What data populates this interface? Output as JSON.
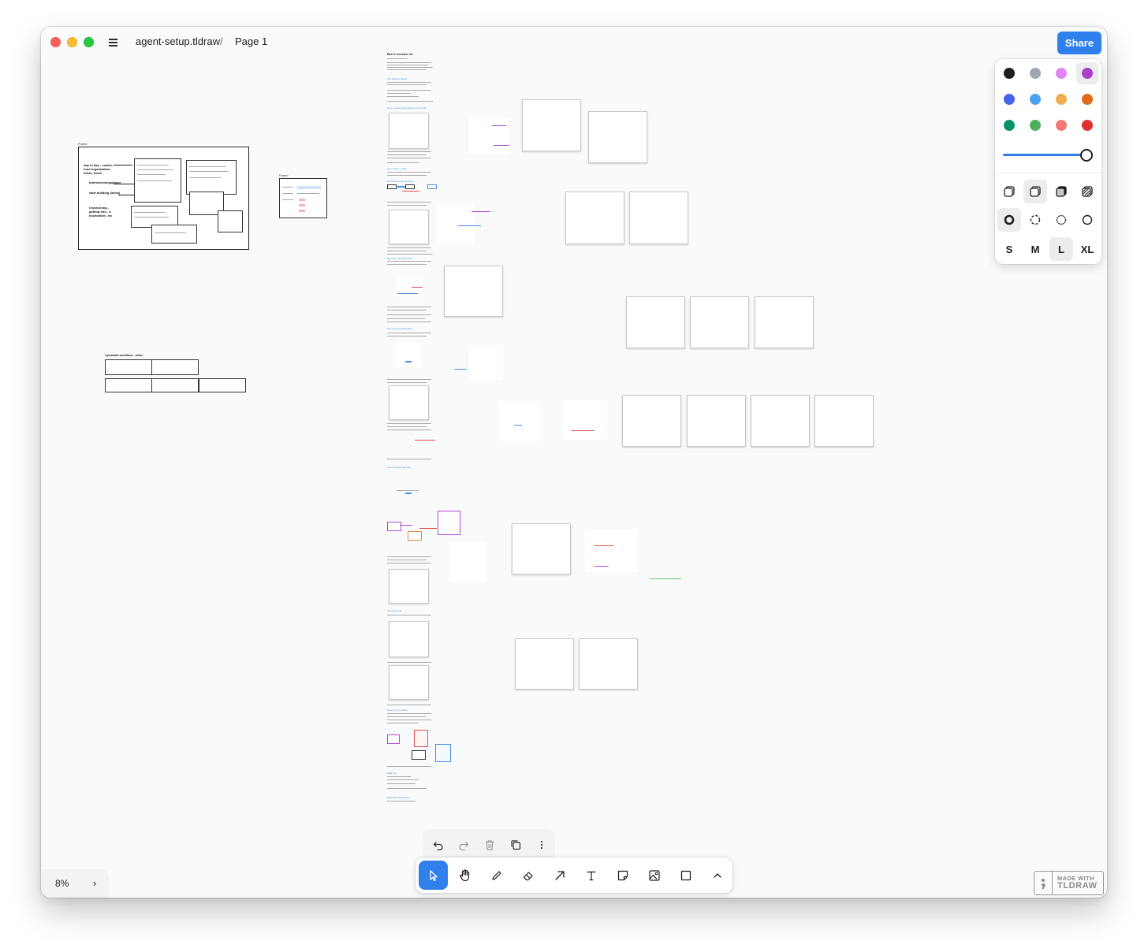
{
  "window": {
    "file_title": "agent-setup.tldraw",
    "separator": "/",
    "page_name": "Page 1",
    "share_label": "Share"
  },
  "canvas": {
    "frame_big_label": "Frame",
    "frame_small_label": "Frame",
    "frame_big_items": [
      "day to day - emails, fund organization, ticket, travel",
      "brainstorming/advice",
      "start building (ideas)",
      "researching - getting info - a bookmarks, etc"
    ],
    "workflow_title": "repeatable workflows - ideas",
    "doc_title": "Ben's session #3",
    "doc_headings": [
      "The starting model",
      "Give it a peek and getting to the code",
      "get context + work",
      "the whole of git (hooking)",
      "Big reset with Postcode",
      "the memory (ideal) kind",
      "Link it product @ code",
      "Using the tool",
      "Here it is on a state",
      "Wrap up",
      "What will the success"
    ]
  },
  "style_panel": {
    "colors": [
      {
        "name": "black",
        "hex": "#1d1d1d"
      },
      {
        "name": "grey",
        "hex": "#9fa8b2"
      },
      {
        "name": "light-violet",
        "hex": "#e085f4"
      },
      {
        "name": "violet",
        "hex": "#ae3ec9"
      },
      {
        "name": "blue",
        "hex": "#4465e9"
      },
      {
        "name": "light-blue",
        "hex": "#4ba1f1"
      },
      {
        "name": "yellow",
        "hex": "#f1ac4b"
      },
      {
        "name": "orange",
        "hex": "#e16919"
      },
      {
        "name": "green",
        "hex": "#099268"
      },
      {
        "name": "light-green",
        "hex": "#4cb05e"
      },
      {
        "name": "light-red",
        "hex": "#f87777"
      },
      {
        "name": "red",
        "hex": "#e03131"
      }
    ],
    "selected_color": "violet",
    "opacity": 1.0,
    "fill_icons": [
      "fill-none-icon",
      "fill-semi-icon",
      "fill-solid-icon",
      "fill-pattern-icon"
    ],
    "dash_icons": [
      "dash-draw-icon",
      "dash-dashed-icon",
      "dash-dotted-icon",
      "dash-solid-icon"
    ],
    "sizes": [
      "S",
      "M",
      "L",
      "XL"
    ],
    "selected_size": "L"
  },
  "zoom": {
    "level": "8%",
    "chevron": "›"
  },
  "toolbar": {
    "tools": [
      "select",
      "hand",
      "draw",
      "eraser",
      "arrow",
      "text",
      "note",
      "asset",
      "rectangle",
      "more"
    ],
    "selected_tool": "select"
  },
  "actions": [
    "undo",
    "redo",
    "delete",
    "duplicate",
    "more"
  ],
  "watermark": {
    "line1": "MADE WITH",
    "line2": "TLDRAW"
  }
}
